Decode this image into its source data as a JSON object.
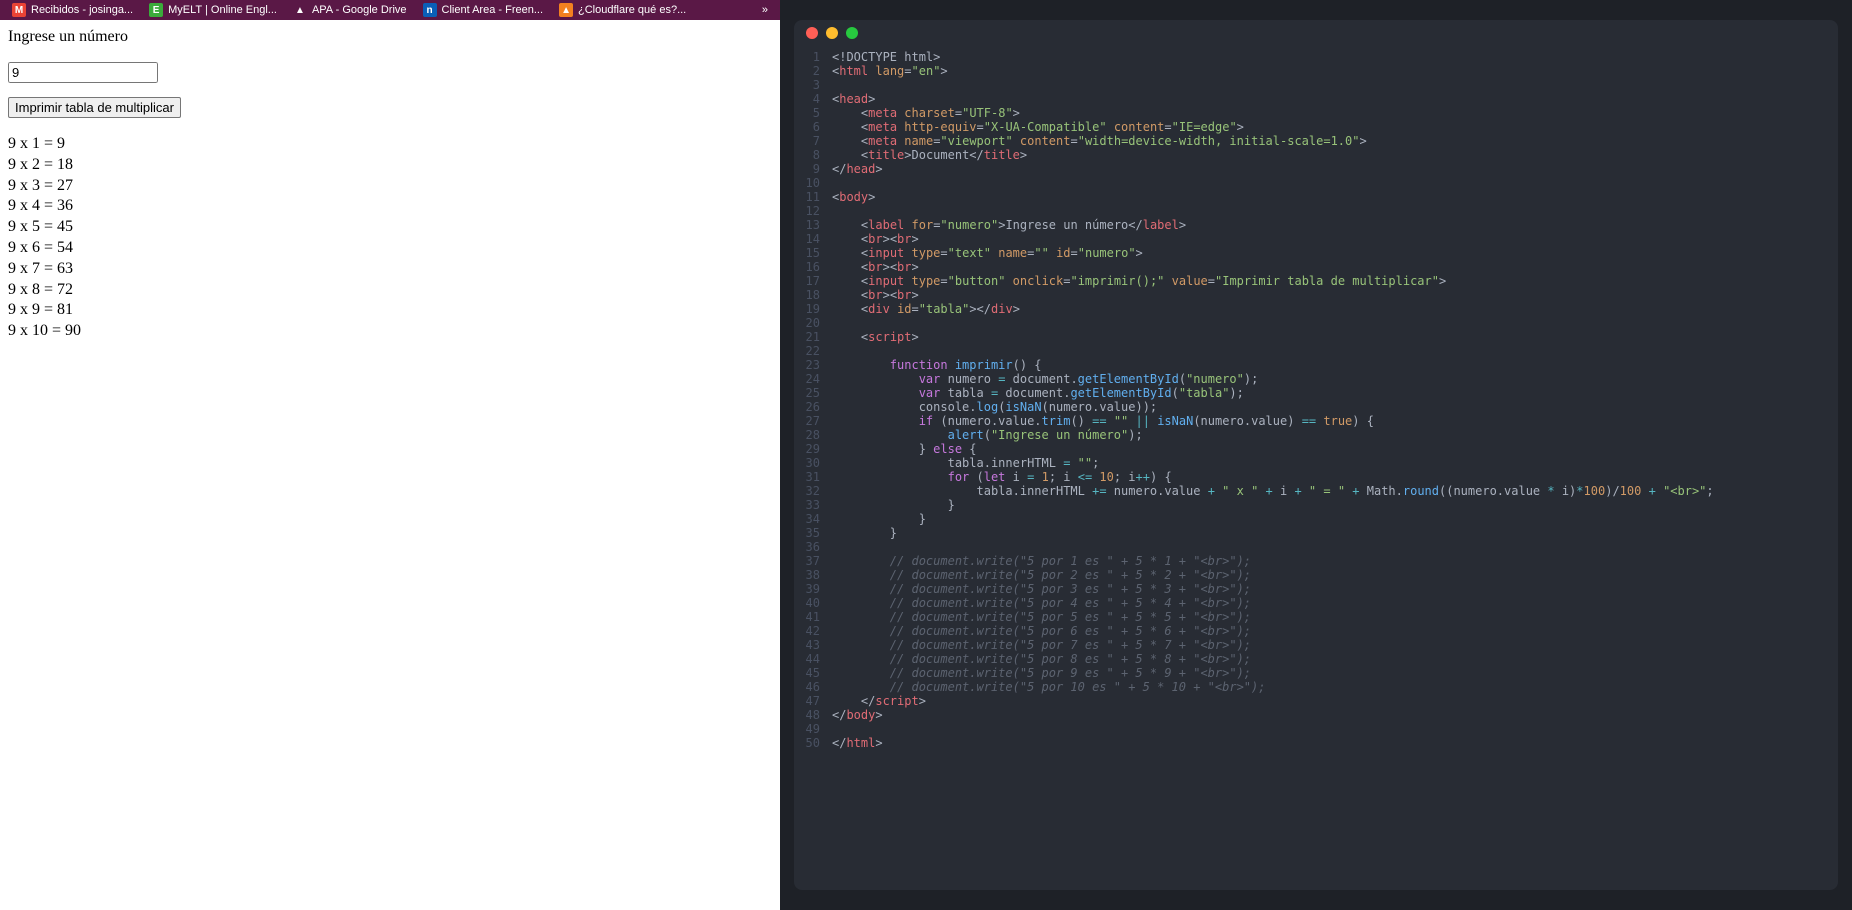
{
  "bookmarks": [
    {
      "label": "Recibidos - josinga...",
      "iconClass": "gmail-icon",
      "iconText": "M"
    },
    {
      "label": "MyELT | Online Engl...",
      "iconClass": "myelt-icon",
      "iconText": "E"
    },
    {
      "label": "APA - Google Drive",
      "iconClass": "drive-icon",
      "iconText": "▲"
    },
    {
      "label": "Client Area - Freen...",
      "iconClass": "free-icon",
      "iconText": "n"
    },
    {
      "label": "¿Cloudflare qué es?...",
      "iconClass": "cloud-icon",
      "iconText": "▲"
    }
  ],
  "overflow": "»",
  "page": {
    "label": "Ingrese un número",
    "inputValue": "9",
    "buttonLabel": "Imprimir tabla de multiplicar",
    "outputLines": [
      "9 x 1 = 9",
      "9 x 2 = 18",
      "9 x 3 = 27",
      "9 x 4 = 36",
      "9 x 5 = 45",
      "9 x 6 = 54",
      "9 x 7 = 63",
      "9 x 8 = 72",
      "9 x 9 = 81",
      "9 x 10 = 90"
    ]
  },
  "code": [
    {
      "n": 1,
      "tokens": [
        [
          "punc",
          "<"
        ],
        [
          "doctype",
          "!DOCTYPE html"
        ],
        [
          "punc",
          ">"
        ]
      ]
    },
    {
      "n": 2,
      "tokens": [
        [
          "punc",
          "<"
        ],
        [
          "tag",
          "html"
        ],
        [
          "text",
          " "
        ],
        [
          "attr",
          "lang"
        ],
        [
          "punc",
          "="
        ],
        [
          "str",
          "\"en\""
        ],
        [
          "punc",
          ">"
        ]
      ]
    },
    {
      "n": 3,
      "tokens": []
    },
    {
      "n": 4,
      "tokens": [
        [
          "punc",
          "<"
        ],
        [
          "tag",
          "head"
        ],
        [
          "punc",
          ">"
        ]
      ]
    },
    {
      "n": 5,
      "tokens": [
        [
          "text",
          "    "
        ],
        [
          "punc",
          "<"
        ],
        [
          "tag",
          "meta"
        ],
        [
          "text",
          " "
        ],
        [
          "attr",
          "charset"
        ],
        [
          "punc",
          "="
        ],
        [
          "str",
          "\"UTF-8\""
        ],
        [
          "punc",
          ">"
        ]
      ]
    },
    {
      "n": 6,
      "tokens": [
        [
          "text",
          "    "
        ],
        [
          "punc",
          "<"
        ],
        [
          "tag",
          "meta"
        ],
        [
          "text",
          " "
        ],
        [
          "attr",
          "http-equiv"
        ],
        [
          "punc",
          "="
        ],
        [
          "str",
          "\"X-UA-Compatible\""
        ],
        [
          "text",
          " "
        ],
        [
          "attr",
          "content"
        ],
        [
          "punc",
          "="
        ],
        [
          "str",
          "\"IE=edge\""
        ],
        [
          "punc",
          ">"
        ]
      ]
    },
    {
      "n": 7,
      "tokens": [
        [
          "text",
          "    "
        ],
        [
          "punc",
          "<"
        ],
        [
          "tag",
          "meta"
        ],
        [
          "text",
          " "
        ],
        [
          "attr",
          "name"
        ],
        [
          "punc",
          "="
        ],
        [
          "str",
          "\"viewport\""
        ],
        [
          "text",
          " "
        ],
        [
          "attr",
          "content"
        ],
        [
          "punc",
          "="
        ],
        [
          "str",
          "\"width=device-width, initial-scale=1.0\""
        ],
        [
          "punc",
          ">"
        ]
      ]
    },
    {
      "n": 8,
      "tokens": [
        [
          "text",
          "    "
        ],
        [
          "punc",
          "<"
        ],
        [
          "tag",
          "title"
        ],
        [
          "punc",
          ">"
        ],
        [
          "text",
          "Document"
        ],
        [
          "punc",
          "</"
        ],
        [
          "tag",
          "title"
        ],
        [
          "punc",
          ">"
        ]
      ]
    },
    {
      "n": 9,
      "tokens": [
        [
          "punc",
          "</"
        ],
        [
          "tag",
          "head"
        ],
        [
          "punc",
          ">"
        ]
      ]
    },
    {
      "n": 10,
      "tokens": []
    },
    {
      "n": 11,
      "tokens": [
        [
          "punc",
          "<"
        ],
        [
          "tag",
          "body"
        ],
        [
          "punc",
          ">"
        ]
      ]
    },
    {
      "n": 12,
      "tokens": []
    },
    {
      "n": 13,
      "tokens": [
        [
          "text",
          "    "
        ],
        [
          "punc",
          "<"
        ],
        [
          "tag",
          "label"
        ],
        [
          "text",
          " "
        ],
        [
          "attr",
          "for"
        ],
        [
          "punc",
          "="
        ],
        [
          "str",
          "\"numero\""
        ],
        [
          "punc",
          ">"
        ],
        [
          "text",
          "Ingrese un número"
        ],
        [
          "punc",
          "</"
        ],
        [
          "tag",
          "label"
        ],
        [
          "punc",
          ">"
        ]
      ]
    },
    {
      "n": 14,
      "tokens": [
        [
          "text",
          "    "
        ],
        [
          "punc",
          "<"
        ],
        [
          "tag",
          "br"
        ],
        [
          "punc",
          "><"
        ],
        [
          "tag",
          "br"
        ],
        [
          "punc",
          ">"
        ]
      ]
    },
    {
      "n": 15,
      "tokens": [
        [
          "text",
          "    "
        ],
        [
          "punc",
          "<"
        ],
        [
          "tag",
          "input"
        ],
        [
          "text",
          " "
        ],
        [
          "attr",
          "type"
        ],
        [
          "punc",
          "="
        ],
        [
          "str",
          "\"text\""
        ],
        [
          "text",
          " "
        ],
        [
          "attr",
          "name"
        ],
        [
          "punc",
          "="
        ],
        [
          "str",
          "\"\""
        ],
        [
          "text",
          " "
        ],
        [
          "attr",
          "id"
        ],
        [
          "punc",
          "="
        ],
        [
          "str",
          "\"numero\""
        ],
        [
          "punc",
          ">"
        ]
      ]
    },
    {
      "n": 16,
      "tokens": [
        [
          "text",
          "    "
        ],
        [
          "punc",
          "<"
        ],
        [
          "tag",
          "br"
        ],
        [
          "punc",
          "><"
        ],
        [
          "tag",
          "br"
        ],
        [
          "punc",
          ">"
        ]
      ]
    },
    {
      "n": 17,
      "tokens": [
        [
          "text",
          "    "
        ],
        [
          "punc",
          "<"
        ],
        [
          "tag",
          "input"
        ],
        [
          "text",
          " "
        ],
        [
          "attr",
          "type"
        ],
        [
          "punc",
          "="
        ],
        [
          "str",
          "\"button\""
        ],
        [
          "text",
          " "
        ],
        [
          "attr",
          "onclick"
        ],
        [
          "punc",
          "="
        ],
        [
          "str",
          "\"imprimir();\""
        ],
        [
          "text",
          " "
        ],
        [
          "attr",
          "value"
        ],
        [
          "punc",
          "="
        ],
        [
          "str",
          "\"Imprimir tabla de multiplicar\""
        ],
        [
          "punc",
          ">"
        ]
      ]
    },
    {
      "n": 18,
      "tokens": [
        [
          "text",
          "    "
        ],
        [
          "punc",
          "<"
        ],
        [
          "tag",
          "br"
        ],
        [
          "punc",
          "><"
        ],
        [
          "tag",
          "br"
        ],
        [
          "punc",
          ">"
        ]
      ]
    },
    {
      "n": 19,
      "tokens": [
        [
          "text",
          "    "
        ],
        [
          "punc",
          "<"
        ],
        [
          "tag",
          "div"
        ],
        [
          "text",
          " "
        ],
        [
          "attr",
          "id"
        ],
        [
          "punc",
          "="
        ],
        [
          "str",
          "\"tabla\""
        ],
        [
          "punc",
          "></"
        ],
        [
          "tag",
          "div"
        ],
        [
          "punc",
          ">"
        ]
      ]
    },
    {
      "n": 20,
      "tokens": []
    },
    {
      "n": 21,
      "tokens": [
        [
          "text",
          "    "
        ],
        [
          "punc",
          "<"
        ],
        [
          "tag",
          "script"
        ],
        [
          "punc",
          ">"
        ]
      ]
    },
    {
      "n": 22,
      "tokens": []
    },
    {
      "n": 23,
      "tokens": [
        [
          "text",
          "        "
        ],
        [
          "kw",
          "function"
        ],
        [
          "text",
          " "
        ],
        [
          "fn",
          "imprimir"
        ],
        [
          "punc",
          "() {"
        ]
      ]
    },
    {
      "n": 24,
      "tokens": [
        [
          "text",
          "            "
        ],
        [
          "kw",
          "var"
        ],
        [
          "text",
          " numero "
        ],
        [
          "op",
          "="
        ],
        [
          "text",
          " document."
        ],
        [
          "fn",
          "getElementById"
        ],
        [
          "punc",
          "("
        ],
        [
          "str",
          "\"numero\""
        ],
        [
          "punc",
          ");"
        ]
      ]
    },
    {
      "n": 25,
      "tokens": [
        [
          "text",
          "            "
        ],
        [
          "kw",
          "var"
        ],
        [
          "text",
          " tabla "
        ],
        [
          "op",
          "="
        ],
        [
          "text",
          " document."
        ],
        [
          "fn",
          "getElementById"
        ],
        [
          "punc",
          "("
        ],
        [
          "str",
          "\"tabla\""
        ],
        [
          "punc",
          ");"
        ]
      ]
    },
    {
      "n": 26,
      "tokens": [
        [
          "text",
          "            console."
        ],
        [
          "fn",
          "log"
        ],
        [
          "punc",
          "("
        ],
        [
          "fn",
          "isNaN"
        ],
        [
          "punc",
          "(numero.value));"
        ]
      ]
    },
    {
      "n": 27,
      "tokens": [
        [
          "text",
          "            "
        ],
        [
          "kw",
          "if"
        ],
        [
          "text",
          " (numero.value."
        ],
        [
          "fn",
          "trim"
        ],
        [
          "punc",
          "() "
        ],
        [
          "op",
          "=="
        ],
        [
          "text",
          " "
        ],
        [
          "str",
          "\"\""
        ],
        [
          "text",
          " "
        ],
        [
          "op",
          "||"
        ],
        [
          "text",
          " "
        ],
        [
          "fn",
          "isNaN"
        ],
        [
          "punc",
          "(numero.value) "
        ],
        [
          "op",
          "=="
        ],
        [
          "text",
          " "
        ],
        [
          "bool",
          "true"
        ],
        [
          "punc",
          ") {"
        ]
      ]
    },
    {
      "n": 28,
      "tokens": [
        [
          "text",
          "                "
        ],
        [
          "fn",
          "alert"
        ],
        [
          "punc",
          "("
        ],
        [
          "str",
          "\"Ingrese un número\""
        ],
        [
          "punc",
          ");"
        ]
      ]
    },
    {
      "n": 29,
      "tokens": [
        [
          "text",
          "            } "
        ],
        [
          "kw",
          "else"
        ],
        [
          "punc",
          " {"
        ]
      ]
    },
    {
      "n": 30,
      "tokens": [
        [
          "text",
          "                tabla.innerHTML "
        ],
        [
          "op",
          "="
        ],
        [
          "text",
          " "
        ],
        [
          "str",
          "\"\""
        ],
        [
          "punc",
          ";"
        ]
      ]
    },
    {
      "n": 31,
      "tokens": [
        [
          "text",
          "                "
        ],
        [
          "kw",
          "for"
        ],
        [
          "text",
          " ("
        ],
        [
          "kw",
          "let"
        ],
        [
          "text",
          " i "
        ],
        [
          "op",
          "="
        ],
        [
          "text",
          " "
        ],
        [
          "num",
          "1"
        ],
        [
          "punc",
          "; i "
        ],
        [
          "op",
          "<="
        ],
        [
          "text",
          " "
        ],
        [
          "num",
          "10"
        ],
        [
          "punc",
          "; i"
        ],
        [
          "op",
          "++"
        ],
        [
          "punc",
          ") {"
        ]
      ]
    },
    {
      "n": 32,
      "tokens": [
        [
          "text",
          "                    tabla.innerHTML "
        ],
        [
          "op",
          "+="
        ],
        [
          "text",
          " numero.value "
        ],
        [
          "op",
          "+"
        ],
        [
          "text",
          " "
        ],
        [
          "str",
          "\" x \""
        ],
        [
          "text",
          " "
        ],
        [
          "op",
          "+"
        ],
        [
          "text",
          " i "
        ],
        [
          "op",
          "+"
        ],
        [
          "text",
          " "
        ],
        [
          "str",
          "\" = \""
        ],
        [
          "text",
          " "
        ],
        [
          "op",
          "+"
        ],
        [
          "text",
          " Math."
        ],
        [
          "fn",
          "round"
        ],
        [
          "punc",
          "((numero.value "
        ],
        [
          "op",
          "*"
        ],
        [
          "text",
          " i)"
        ],
        [
          "op",
          "*"
        ],
        [
          "num",
          "100"
        ],
        [
          "punc",
          ")/"
        ],
        [
          "num",
          "100"
        ],
        [
          "text",
          " "
        ],
        [
          "op",
          "+"
        ],
        [
          "text",
          " "
        ],
        [
          "str",
          "\"<br>\""
        ],
        [
          "punc",
          ";"
        ]
      ]
    },
    {
      "n": 33,
      "tokens": [
        [
          "text",
          "                }"
        ]
      ]
    },
    {
      "n": 34,
      "tokens": [
        [
          "text",
          "            }"
        ]
      ]
    },
    {
      "n": 35,
      "tokens": [
        [
          "text",
          "        }"
        ]
      ]
    },
    {
      "n": 36,
      "tokens": []
    },
    {
      "n": 37,
      "tokens": [
        [
          "text",
          "        "
        ],
        [
          "cmt",
          "// document.write(\"5 por 1 es \" + 5 * 1 + \"<br>\");"
        ]
      ]
    },
    {
      "n": 38,
      "tokens": [
        [
          "text",
          "        "
        ],
        [
          "cmt",
          "// document.write(\"5 por 2 es \" + 5 * 2 + \"<br>\");"
        ]
      ]
    },
    {
      "n": 39,
      "tokens": [
        [
          "text",
          "        "
        ],
        [
          "cmt",
          "// document.write(\"5 por 3 es \" + 5 * 3 + \"<br>\");"
        ]
      ]
    },
    {
      "n": 40,
      "tokens": [
        [
          "text",
          "        "
        ],
        [
          "cmt",
          "// document.write(\"5 por 4 es \" + 5 * 4 + \"<br>\");"
        ]
      ]
    },
    {
      "n": 41,
      "tokens": [
        [
          "text",
          "        "
        ],
        [
          "cmt",
          "// document.write(\"5 por 5 es \" + 5 * 5 + \"<br>\");"
        ]
      ]
    },
    {
      "n": 42,
      "tokens": [
        [
          "text",
          "        "
        ],
        [
          "cmt",
          "// document.write(\"5 por 6 es \" + 5 * 6 + \"<br>\");"
        ]
      ]
    },
    {
      "n": 43,
      "tokens": [
        [
          "text",
          "        "
        ],
        [
          "cmt",
          "// document.write(\"5 por 7 es \" + 5 * 7 + \"<br>\");"
        ]
      ]
    },
    {
      "n": 44,
      "tokens": [
        [
          "text",
          "        "
        ],
        [
          "cmt",
          "// document.write(\"5 por 8 es \" + 5 * 8 + \"<br>\");"
        ]
      ]
    },
    {
      "n": 45,
      "tokens": [
        [
          "text",
          "        "
        ],
        [
          "cmt",
          "// document.write(\"5 por 9 es \" + 5 * 9 + \"<br>\");"
        ]
      ]
    },
    {
      "n": 46,
      "tokens": [
        [
          "text",
          "        "
        ],
        [
          "cmt",
          "// document.write(\"5 por 10 es \" + 5 * 10 + \"<br>\");"
        ]
      ]
    },
    {
      "n": 47,
      "tokens": [
        [
          "text",
          "    "
        ],
        [
          "punc",
          "</"
        ],
        [
          "tag",
          "script"
        ],
        [
          "punc",
          ">"
        ]
      ]
    },
    {
      "n": 48,
      "tokens": [
        [
          "punc",
          "</"
        ],
        [
          "tag",
          "body"
        ],
        [
          "punc",
          ">"
        ]
      ]
    },
    {
      "n": 49,
      "tokens": []
    },
    {
      "n": 50,
      "tokens": [
        [
          "punc",
          "</"
        ],
        [
          "tag",
          "html"
        ],
        [
          "punc",
          ">"
        ]
      ]
    }
  ]
}
